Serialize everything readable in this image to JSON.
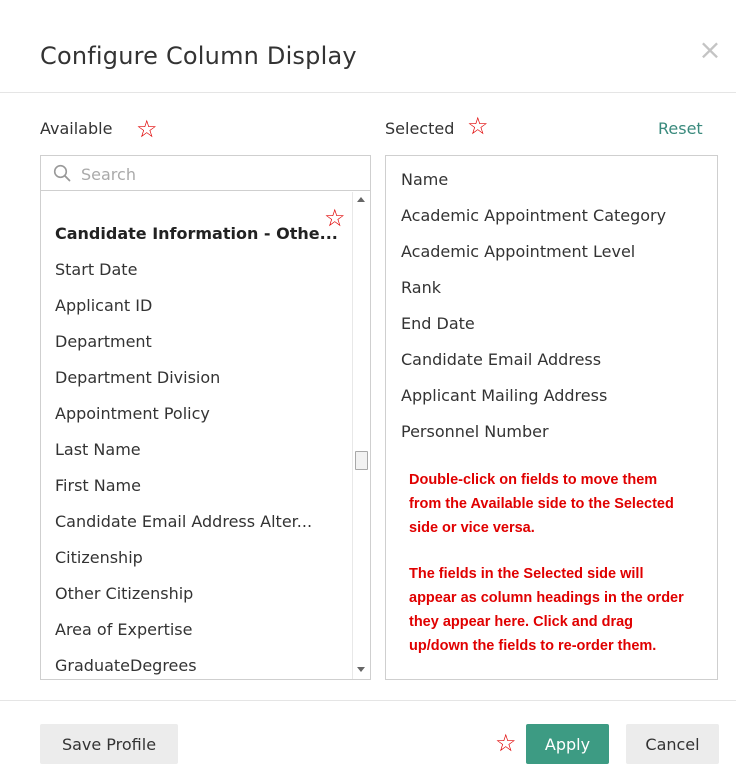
{
  "dialog": {
    "title": "Configure Column Display",
    "close_icon": "close-icon"
  },
  "available": {
    "label": "Available",
    "search_placeholder": "Search",
    "items": [
      {
        "label": "Candidate Information - Othe...",
        "group_header": true
      },
      {
        "label": "Start Date"
      },
      {
        "label": "Applicant ID"
      },
      {
        "label": "Department"
      },
      {
        "label": "Department Division"
      },
      {
        "label": "Appointment Policy"
      },
      {
        "label": "Last Name"
      },
      {
        "label": "First Name"
      },
      {
        "label": "Candidate Email Address Alter..."
      },
      {
        "label": "Citizenship"
      },
      {
        "label": "Other Citizenship"
      },
      {
        "label": "Area of Expertise"
      },
      {
        "label": "GraduateDegrees"
      }
    ]
  },
  "selected": {
    "label": "Selected",
    "reset_label": "Reset",
    "items": [
      {
        "label": "Name"
      },
      {
        "label": "Academic Appointment Category"
      },
      {
        "label": "Academic Appointment Level"
      },
      {
        "label": "Rank"
      },
      {
        "label": "End Date"
      },
      {
        "label": "Candidate Email Address"
      },
      {
        "label": "Applicant Mailing Address"
      },
      {
        "label": "Personnel Number"
      }
    ],
    "notes": {
      "line1": "Double-click on fields to move them",
      "line2": "from the Available side to the Selected",
      "line3": "side or vice versa.",
      "line4": "The fields in the Selected side will",
      "line5": "appear as column headings in the order",
      "line6": "they appear here. Click and drag",
      "line7": "up/down the fields to re-order them."
    }
  },
  "footer": {
    "save_profile_label": "Save Profile",
    "apply_label": "Apply",
    "cancel_label": "Cancel"
  },
  "annotation_star": "☆",
  "colors": {
    "accent": "#3d9b83",
    "reset_link": "#3a8a7d",
    "annotation_red": "#e00000"
  }
}
